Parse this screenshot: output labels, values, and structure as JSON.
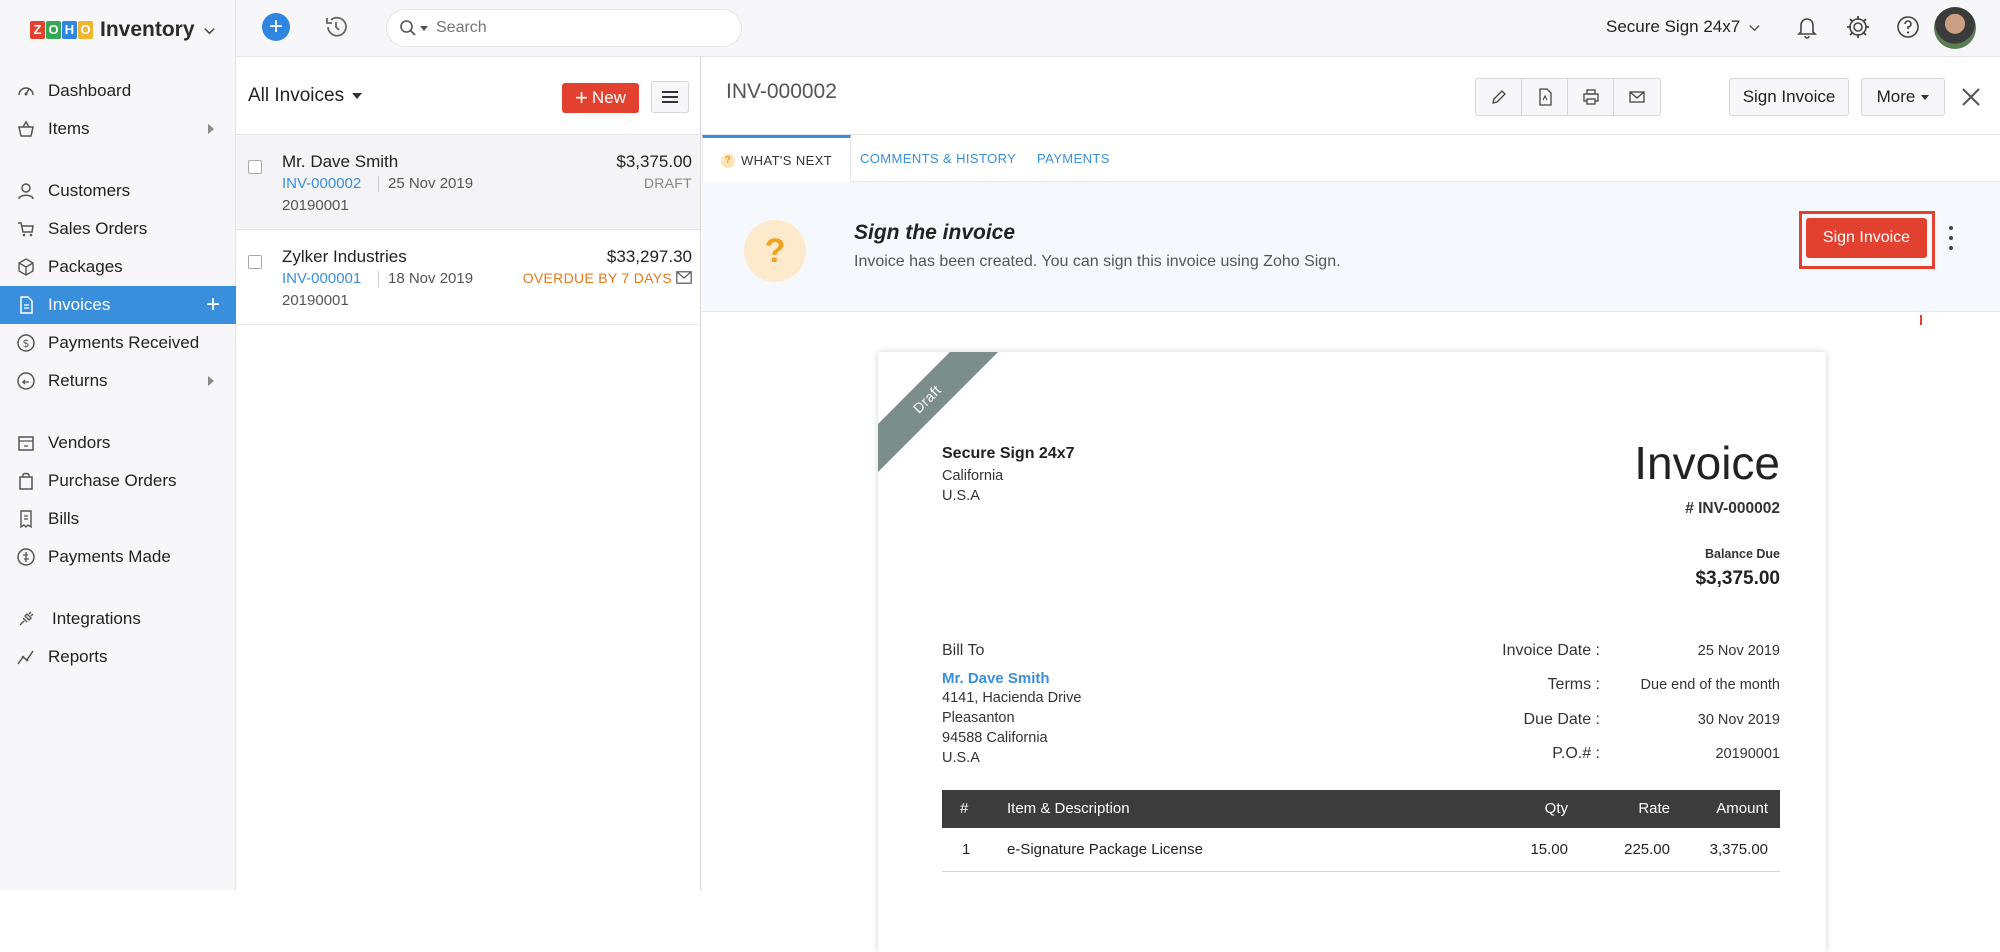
{
  "app": {
    "brand": "Inventory",
    "logo_letters": [
      "Z",
      "O",
      "H",
      "O"
    ],
    "logo_colors": [
      "#e2412f",
      "#35a853",
      "#2f86e0",
      "#f2b52e"
    ]
  },
  "topbar": {
    "search_placeholder": "Search",
    "org_name": "Secure Sign 24x7"
  },
  "sidebar": {
    "items": [
      {
        "label": "Dashboard"
      },
      {
        "label": "Items"
      },
      {
        "label": "Customers"
      },
      {
        "label": "Sales Orders"
      },
      {
        "label": "Packages"
      },
      {
        "label": "Invoices"
      },
      {
        "label": "Payments Received"
      },
      {
        "label": "Returns"
      },
      {
        "label": "Vendors"
      },
      {
        "label": "Purchase Orders"
      },
      {
        "label": "Bills"
      },
      {
        "label": "Payments Made"
      },
      {
        "label": "Integrations"
      },
      {
        "label": "Reports"
      }
    ]
  },
  "list": {
    "title": "All Invoices",
    "new_label": "New",
    "rows": [
      {
        "customer": "Mr. Dave Smith",
        "amount": "$3,375.00",
        "number": "INV-000002",
        "date": "25 Nov 2019",
        "reference": "20190001",
        "status": "DRAFT"
      },
      {
        "customer": "Zylker Industries",
        "amount": "$33,297.30",
        "number": "INV-000001",
        "date": "18 Nov 2019",
        "reference": "20190001",
        "status": "OVERDUE BY 7 DAYS"
      }
    ]
  },
  "detail": {
    "title": "INV-000002",
    "sign_invoice_label": "Sign Invoice",
    "more_label": "More",
    "tabs": [
      {
        "label": "WHAT'S NEXT"
      },
      {
        "label": "COMMENTS & HISTORY"
      },
      {
        "label": "PAYMENTS"
      }
    ],
    "banner": {
      "title": "Sign the invoice",
      "description": "Invoice has been created. You can sign this invoice using Zoho Sign.",
      "button": "Sign Invoice"
    }
  },
  "invoice": {
    "ribbon": "Draft",
    "from": {
      "name": "Secure Sign 24x7",
      "line1": "California",
      "line2": "U.S.A"
    },
    "heading": "Invoice",
    "number": "# INV-000002",
    "balance_label": "Balance Due",
    "balance": "$3,375.00",
    "bill_to_label": "Bill To",
    "bill_to": {
      "name": "Mr. Dave Smith",
      "line1": "4141, Hacienda Drive",
      "line2": "Pleasanton",
      "line3": "94588 California",
      "line4": "U.S.A"
    },
    "meta": [
      {
        "label": "Invoice Date :",
        "value": "25 Nov 2019"
      },
      {
        "label": "Terms :",
        "value": "Due end of the month"
      },
      {
        "label": "Due Date :",
        "value": "30 Nov 2019"
      },
      {
        "label": "P.O.# :",
        "value": "20190001"
      }
    ],
    "table": {
      "headers": {
        "num": "#",
        "item": "Item & Description",
        "qty": "Qty",
        "rate": "Rate",
        "amount": "Amount"
      },
      "rows": [
        {
          "num": "1",
          "item": "e-Signature Package License",
          "qty": "15.00",
          "rate": "225.00",
          "amount": "3,375.00"
        }
      ]
    }
  }
}
